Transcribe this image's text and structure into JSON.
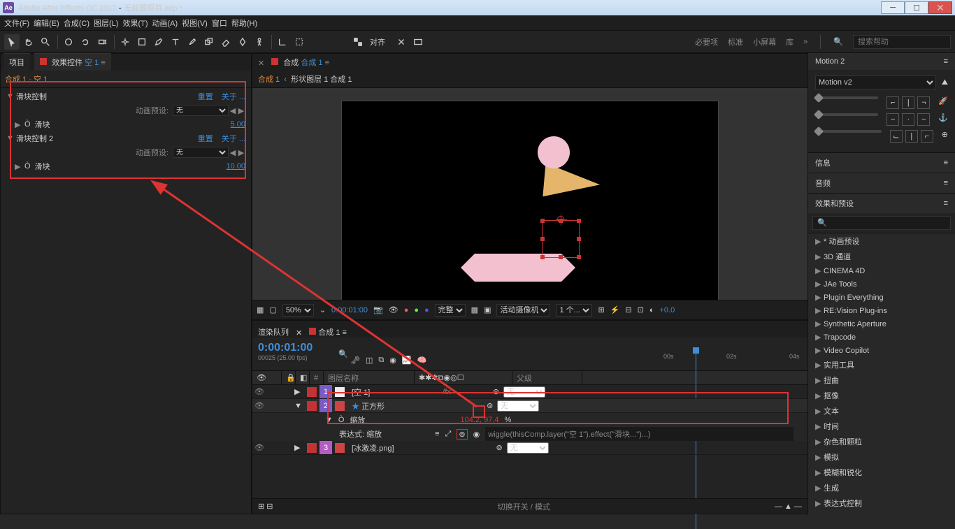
{
  "titlebar": {
    "app": "Adobe After Effects CC 2017",
    "doc": "无标题项目.aep *"
  },
  "menubar": [
    "文件(F)",
    "编辑(E)",
    "合成(C)",
    "图层(L)",
    "效果(T)",
    "动画(A)",
    "视图(V)",
    "窗口",
    "帮助(H)"
  ],
  "toolbar_align": "对齐",
  "workspace": {
    "tabs": [
      "必要项",
      "标准",
      "小屏幕",
      "库"
    ],
    "search_ph": "搜索帮助"
  },
  "left": {
    "tabs": {
      "project": "项目",
      "ecprefix": "效果控件",
      "eclayer": "空 1"
    },
    "subtitle": "合成 1 · 空 1",
    "effects": [
      {
        "name": "滑块控制",
        "reset": "重置",
        "about": "关于 ...",
        "preset_lbl": "动画预设:",
        "preset_val": "无",
        "slider_lbl": "滑块",
        "slider_val": "5.00"
      },
      {
        "name": "滑块控制 2",
        "reset": "重置",
        "about": "关于 ...",
        "preset_lbl": "动画预设:",
        "preset_val": "无",
        "slider_lbl": "滑块",
        "slider_val": "10.00"
      }
    ]
  },
  "viewer": {
    "tab": "合成",
    "comp": "合成 1",
    "bc": [
      "合成 1",
      "形状图层 1 合成 1"
    ],
    "footer": {
      "zoom": "50%",
      "time": "0:00:01:00",
      "res": "完整",
      "cam": "活动摄像机",
      "views": "1 个...",
      "exp": "+0.0"
    }
  },
  "timeline": {
    "tabs": {
      "render": "渲染队列",
      "comp": "合成 1"
    },
    "time": "0:00:01:00",
    "fps": "00025 (25.00 fps)",
    "cols": {
      "num": "#",
      "name": "图层名称",
      "parent": "父级"
    },
    "layers": [
      {
        "num": "1",
        "name": "[空 1]",
        "parent": "无",
        "color": "#eee"
      },
      {
        "num": "2",
        "name": "正方形",
        "parent": "无",
        "color": "#c44"
      }
    ],
    "scale": {
      "tw": "▼",
      "stop": "Ò",
      "label": "缩放",
      "value": "104.2, 97.4",
      "pct": "%"
    },
    "expr": {
      "label": "表达式: 缩放",
      "code": "wiggle(thisComp.layer(\"空 1\").effect(\"滑块...\")...)"
    },
    "layer3": {
      "name": "[冰激凌.png]",
      "parent": "无"
    },
    "ticks": [
      "00s",
      "02s",
      "04s"
    ],
    "bottom": "切换开关 / 模式"
  },
  "right": {
    "motion_panel": "Motion 2",
    "motion_dd": "Motion v2",
    "panels": [
      "信息",
      "音频",
      "效果和预设"
    ],
    "presets": [
      "* 动画预设",
      "3D 通道",
      "CINEMA 4D",
      "JAe Tools",
      "Plugin Everything",
      "RE:Vision Plug-ins",
      "Synthetic Aperture",
      "Trapcode",
      "Video Copilot",
      "实用工具",
      "扭曲",
      "抠像",
      "文本",
      "时间",
      "杂色和颗粒",
      "模拟",
      "模糊和锐化",
      "生成",
      "表达式控制"
    ]
  }
}
